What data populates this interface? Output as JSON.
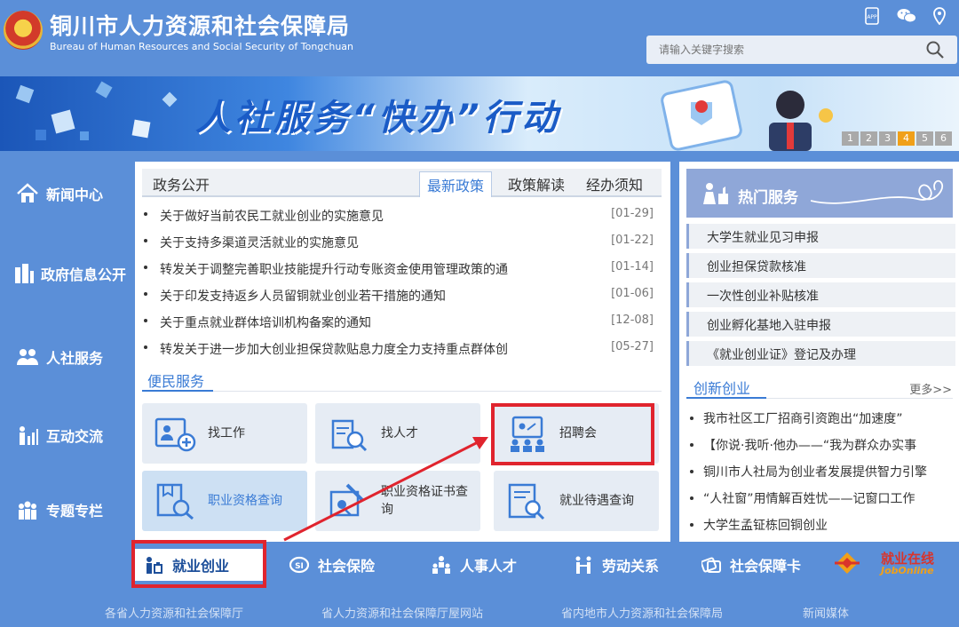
{
  "header": {
    "title": "铜川市人力资源和社会保障局",
    "subtitle": "Bureau of Human Resources and Social Security of Tongchuan",
    "search_placeholder": "请输入关键字搜索",
    "icons": [
      "app-icon",
      "wechat-icon",
      "location-icon"
    ]
  },
  "banner": {
    "title": "人社服务“快办”行动",
    "pages": [
      "1",
      "2",
      "3",
      "4",
      "5",
      "6"
    ],
    "active_page": "4"
  },
  "left_nav": [
    {
      "label": "新闻中心",
      "icon": "home-icon"
    },
    {
      "label": "政府信息公开",
      "icon": "building-icon"
    },
    {
      "label": "人社服务",
      "icon": "people-icon"
    },
    {
      "label": "互动交流",
      "icon": "chart-people-icon"
    },
    {
      "label": "专题专栏",
      "icon": "group-icon"
    }
  ],
  "policy": {
    "section_title": "政务公开",
    "tabs": [
      "最新政策",
      "政策解读",
      "经办须知"
    ],
    "active_tab": "最新政策",
    "items": [
      {
        "title": "关于做好当前农民工就业创业的实施意见",
        "date": "[01-29]"
      },
      {
        "title": "关于支持多渠道灵活就业的实施意见",
        "date": "[01-22]"
      },
      {
        "title": "转发关于调整完善职业技能提升行动专账资金使用管理政策的通",
        "date": "[01-14]"
      },
      {
        "title": "关于印发支持返乡人员留铜就业创业若干措施的通知",
        "date": "[01-06]"
      },
      {
        "title": "关于重点就业群体培训机构备案的通知",
        "date": "[12-08]"
      },
      {
        "title": "转发关于进一步加大创业担保贷款贴息力度全力支持重点群体创",
        "date": "[05-27]"
      }
    ]
  },
  "services": {
    "label": "便民服务",
    "items": [
      {
        "label": "找工作",
        "icon": "job-search-icon"
      },
      {
        "label": "找人才",
        "icon": "talent-search-icon"
      },
      {
        "label": "招聘会",
        "icon": "job-fair-icon"
      },
      {
        "label": "职业资格查询",
        "icon": "qualification-search-icon"
      },
      {
        "label": "职业资格证书查询",
        "icon": "certificate-search-icon"
      },
      {
        "label": "就业待遇查询",
        "icon": "benefit-search-icon"
      }
    ]
  },
  "hot": {
    "title": "热门服务",
    "items": [
      "大学生就业见习申报",
      "创业担保贷款核准",
      "一次性创业补贴核准",
      "创业孵化基地入驻申报",
      "《就业创业证》登记及办理"
    ]
  },
  "innovate": {
    "label": "创新创业",
    "more": "更多>>",
    "items": [
      "我市社区工厂招商引资跑出“加速度”",
      "【你说·我听·他办——“我为群众办实事",
      "铜川市人社局为创业者发展提供智力引擎",
      "“人社窗”用情解百姓忧——记窗口工作",
      "大学生孟钲栋回铜创业"
    ]
  },
  "bottom_nav": [
    {
      "label": "就业创业",
      "icon": "employment-icon"
    },
    {
      "label": "社会保险",
      "icon": "social-insurance-icon"
    },
    {
      "label": "人事人才",
      "icon": "personnel-icon"
    },
    {
      "label": "劳动关系",
      "icon": "labor-relations-icon"
    },
    {
      "label": "社会保障卡",
      "icon": "social-security-card-icon"
    }
  ],
  "jy_logo": {
    "text": "就业在线",
    "sub": "JobOnline"
  },
  "footer": [
    "各省人力资源和社会保障厅",
    "省人力资源和社会保障厅屋网站",
    "省内地市人力资源和社会保障局",
    "新闻媒体"
  ],
  "colors": {
    "background": "#5b8fd8",
    "accent": "#3a7bd5",
    "highlight": "#e0242e",
    "pager_active": "#f0a019"
  }
}
